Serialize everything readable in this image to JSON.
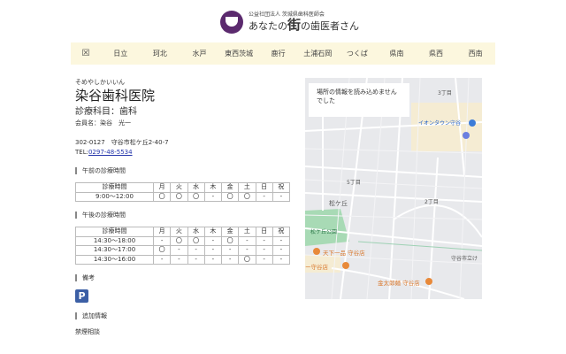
{
  "header": {
    "org": "公益社団法人 茨城県歯科医師会",
    "title_pre": "あなたの",
    "title_big": "街",
    "title_post": "の歯医者さん"
  },
  "nav": {
    "home_icon": "☒",
    "items": [
      "日立",
      "珂北",
      "水戸",
      "東西茨城",
      "鹿行",
      "土浦石岡",
      "つくば",
      "県南",
      "県西",
      "西南"
    ]
  },
  "clinic": {
    "kana": "そめやしかいいん",
    "name": "染谷歯科医院",
    "dept": "診療科目：歯科",
    "member": "会員名：染谷　光一",
    "address": "302-0127　守谷市松ケ丘2-40-7",
    "tel_label": "TEL:",
    "tel": "0297-48-5534"
  },
  "am": {
    "title": "午前の診療時間",
    "header": [
      "診療時間",
      "月",
      "火",
      "水",
      "木",
      "金",
      "土",
      "日",
      "祝"
    ],
    "rows": [
      [
        "9:00〜12:00",
        "〇",
        "〇",
        "〇",
        "-",
        "〇",
        "〇",
        "-",
        "-"
      ]
    ]
  },
  "pm": {
    "title": "午後の診療時間",
    "header": [
      "診療時間",
      "月",
      "火",
      "水",
      "木",
      "金",
      "土",
      "日",
      "祝"
    ],
    "rows": [
      [
        "14:30〜18:00",
        "-",
        "〇",
        "〇",
        "-",
        "〇",
        "-",
        "-",
        "-"
      ],
      [
        "14:30〜17:00",
        "〇",
        "-",
        "-",
        "-",
        "-",
        "-",
        "-",
        "-"
      ],
      [
        "14:30〜16:00",
        "-",
        "-",
        "-",
        "-",
        "-",
        "〇",
        "-",
        "-"
      ]
    ]
  },
  "notes": {
    "title": "備考",
    "parking": "P"
  },
  "extra": {
    "title": "追加情報",
    "text": "禁煙相談"
  },
  "map": {
    "message": "場所の情報を読み込めませんでした",
    "labels": [
      "3丁目",
      "イオンタウン守谷",
      "5丁目",
      "松ケ丘",
      "2丁目",
      "松ケ丘公園",
      "天下一品 守谷店",
      "ー守谷店",
      "金太郎麺 守谷店",
      "守谷市立け"
    ],
    "colors": {
      "park": "#a8dab5",
      "commercial": "#f5ecd3",
      "poi": "#e8893a"
    }
  }
}
